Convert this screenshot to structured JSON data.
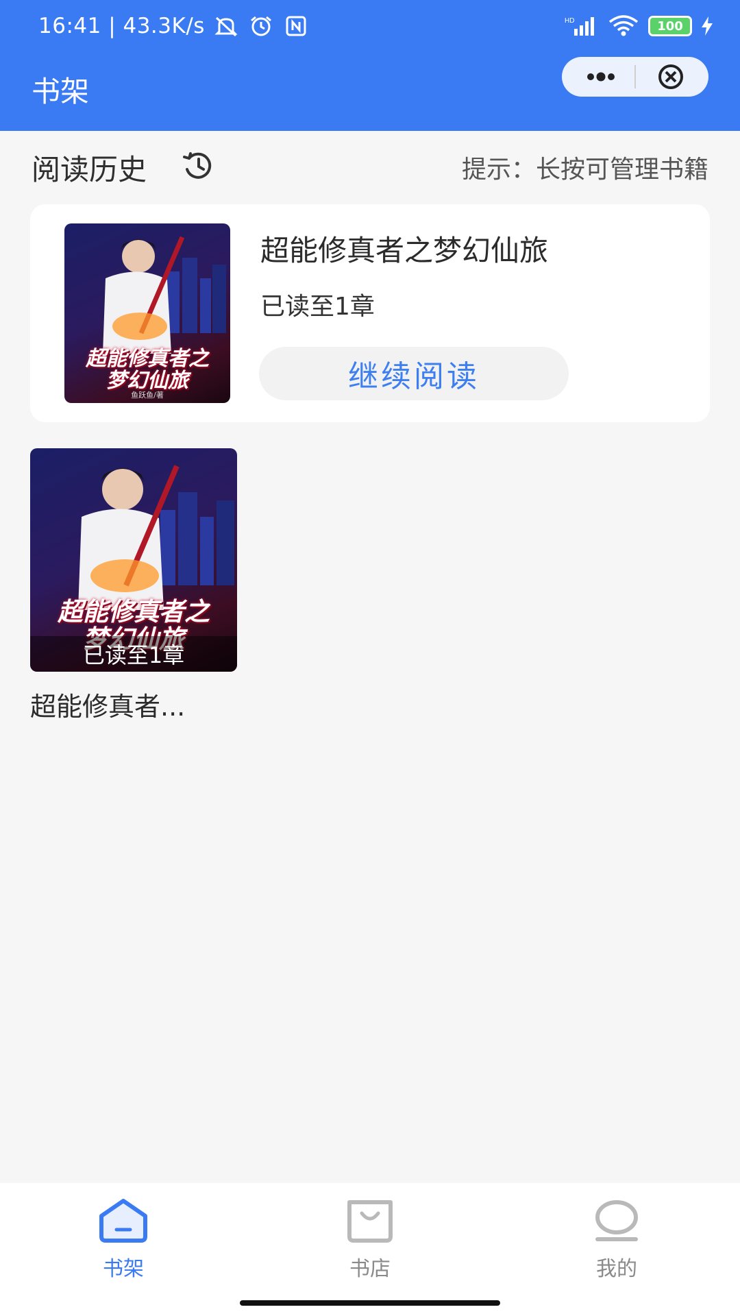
{
  "status_bar": {
    "time": "16:41 | 43.3K/s",
    "network_label": "HD",
    "battery": "100"
  },
  "nav": {
    "title": "书架"
  },
  "history": {
    "title": "阅读历史",
    "tip": "提示：长按可管理书籍",
    "book": {
      "name": "超能修真者之梦幻仙旅",
      "progress": "已读至1章",
      "continue_label": "继续阅读"
    }
  },
  "cover": {
    "title_line1": "超能修真者之",
    "title_line2": "梦幻仙旅",
    "author": "鱼跃鱼/著"
  },
  "shelf": {
    "items": [
      {
        "name": "超能修真者...",
        "progress": "已读至1章"
      }
    ]
  },
  "tabbar": {
    "items": [
      {
        "label": "书架",
        "icon": "home-icon",
        "active": true
      },
      {
        "label": "书店",
        "icon": "shopping-bag-icon",
        "active": false
      },
      {
        "label": "我的",
        "icon": "profile-icon",
        "active": false
      }
    ],
    "active_color": "#3a7bf3",
    "inactive_color": "#8a8a8a"
  },
  "colors": {
    "header_bg": "#3a7bf3",
    "page_bg": "#f6f6f6",
    "accent": "#3d7ff0"
  }
}
